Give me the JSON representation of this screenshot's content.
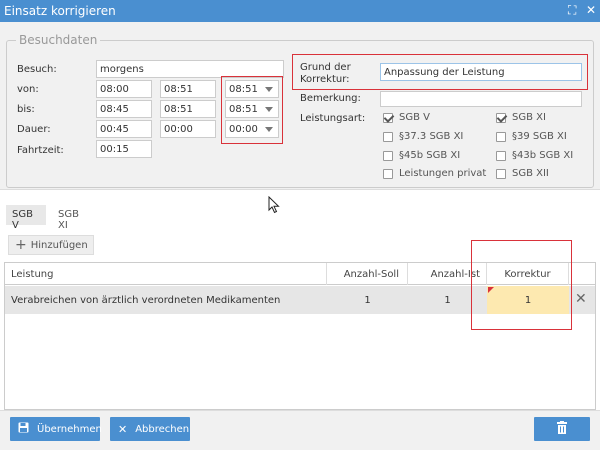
{
  "window": {
    "title": "Einsatz korrigieren",
    "expand_icon": "expand-icon",
    "close_icon": "close-icon",
    "close_glyph": "✕",
    "expand_glyph": "⛶"
  },
  "besuchdaten": {
    "legend": "Besuchdaten",
    "besuch_label": "Besuch:",
    "besuch_value": "morgens",
    "von_label": "von:",
    "von_values": [
      "08:00",
      "08:51",
      "08:51"
    ],
    "bis_label": "bis:",
    "bis_values": [
      "08:45",
      "08:51",
      "08:51"
    ],
    "dauer_label": "Dauer:",
    "dauer_values": [
      "00:45",
      "00:00",
      "00:00"
    ],
    "fahrtzeit_label": "Fahrtzeit:",
    "fahrtzeit_value": "00:15"
  },
  "korrektur": {
    "grund_label": "Grund der Korrektur:",
    "grund_value": "Anpassung der Leistung",
    "bemerkung_label": "Bemerkung:",
    "bemerkung_value": "",
    "leistungsart_label": "Leistungsart:",
    "leistungsarten": [
      {
        "label": "SGB V",
        "checked": true
      },
      {
        "label": "SGB XI",
        "checked": true
      },
      {
        "label": "§37.3 SGB XI",
        "checked": false
      },
      {
        "label": "§39 SGB XI",
        "checked": false
      },
      {
        "label": "§45b SGB XI",
        "checked": false
      },
      {
        "label": "§43b SGB XI",
        "checked": false
      },
      {
        "label": "Leistungen privat",
        "checked": false
      },
      {
        "label": "SGB XII",
        "checked": false
      }
    ]
  },
  "tabs": [
    {
      "label": "SGB V",
      "active": true
    },
    {
      "label": "SGB XI",
      "active": false
    }
  ],
  "add_button": "Hinzufügen",
  "table": {
    "headers": [
      "Leistung",
      "Anzahl-Soll",
      "Anzahl-Ist",
      "Korrektur"
    ],
    "rows": [
      {
        "leistung": "Verabreichen von ärztlich verordneten Medikamenten",
        "soll": "1",
        "ist": "1",
        "korrektur": "1"
      }
    ]
  },
  "footer": {
    "ok_label": "Übernehmen",
    "cancel_label": "Abbrechen"
  },
  "colors": {
    "accent": "#4a8fd0",
    "highlight_cell": "#fde9b0",
    "annotation_red": "#d9323a"
  }
}
